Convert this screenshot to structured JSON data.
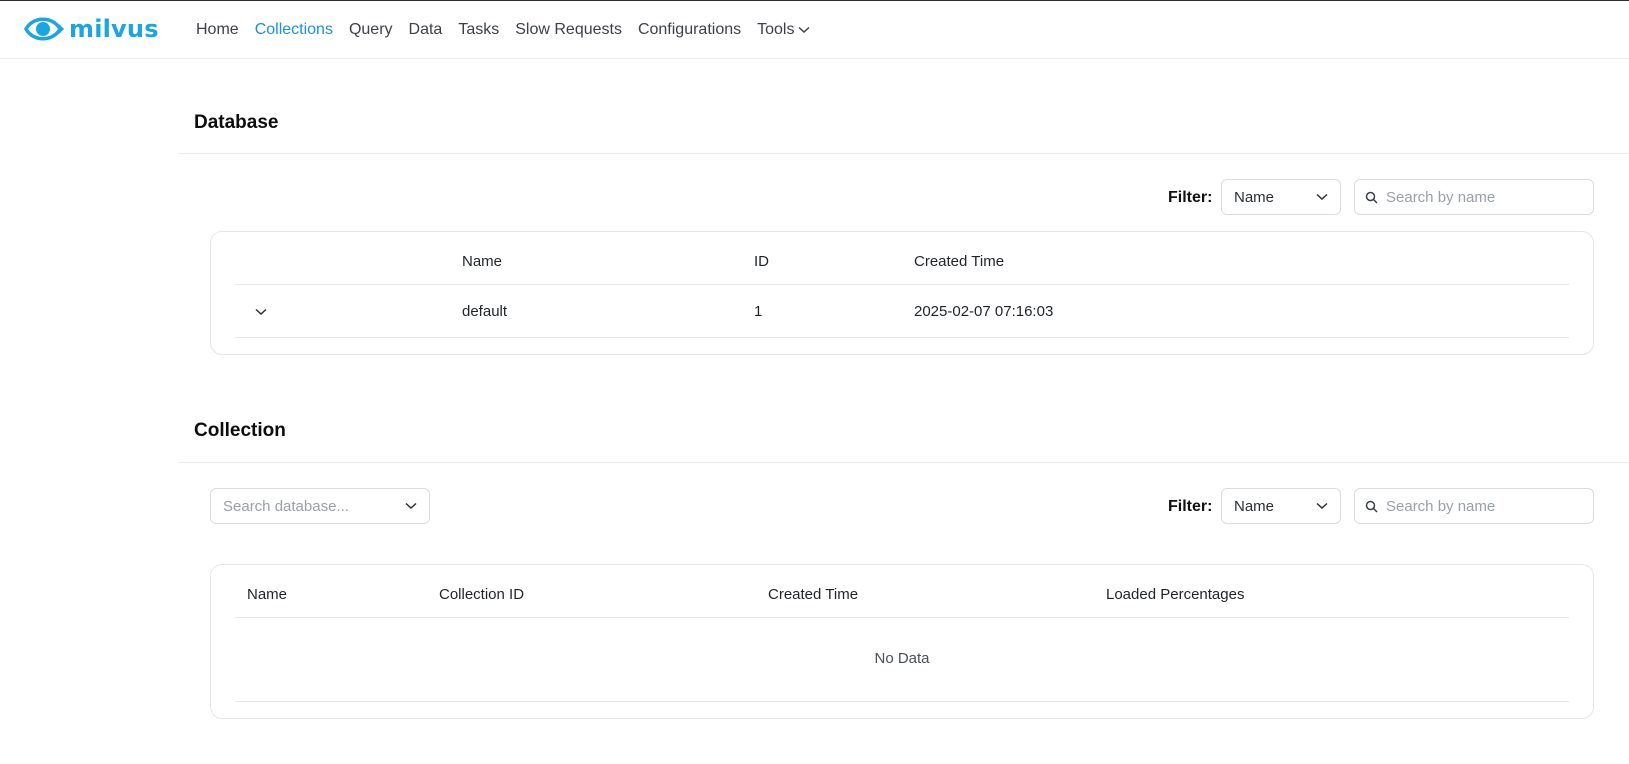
{
  "brand": {
    "name": "milvus",
    "color": "#1ba6e0"
  },
  "nav": {
    "items": [
      {
        "label": "Home",
        "active": false
      },
      {
        "label": "Collections",
        "active": true
      },
      {
        "label": "Query",
        "active": false
      },
      {
        "label": "Data",
        "active": false
      },
      {
        "label": "Tasks",
        "active": false
      },
      {
        "label": "Slow Requests",
        "active": false
      },
      {
        "label": "Configurations",
        "active": false
      },
      {
        "label": "Tools",
        "active": false,
        "icon": "chevron-down-icon"
      }
    ],
    "active_color": "#1e90d6"
  },
  "database": {
    "title": "Database",
    "filter": {
      "label": "Filter:",
      "select_value": "Name",
      "search_placeholder": "Search by name"
    },
    "columns": [
      "Name",
      "ID",
      "Created Time"
    ],
    "rows": [
      {
        "expand_icon": "chevron-down-icon",
        "name": "default",
        "id": "1",
        "created_time": "2025-02-07 07:16:03"
      }
    ]
  },
  "collection": {
    "title": "Collection",
    "database_select_placeholder": "Search database...",
    "filter": {
      "label": "Filter:",
      "select_value": "Name",
      "search_placeholder": "Search by name"
    },
    "columns": [
      "Name",
      "Collection ID",
      "Created Time",
      "Loaded Percentages"
    ],
    "empty_text": "No Data"
  }
}
